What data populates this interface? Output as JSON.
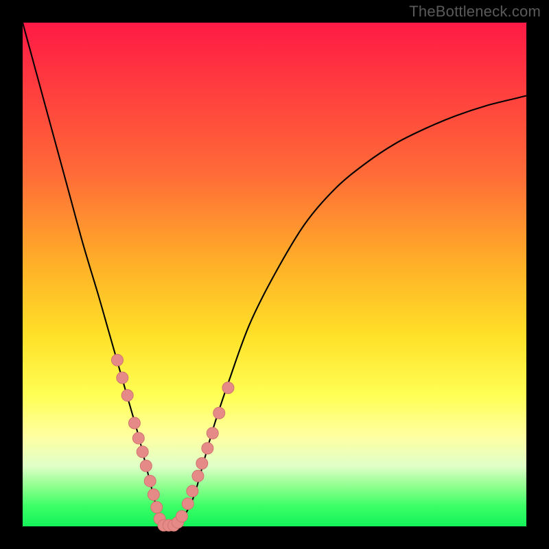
{
  "watermark": {
    "text": "TheBottleneck.com"
  },
  "chart_data": {
    "type": "line",
    "title": "",
    "xlabel": "",
    "ylabel": "",
    "xlim": [
      0,
      100
    ],
    "ylim": [
      0,
      100
    ],
    "grid": false,
    "series": [
      {
        "name": "bottleneck-curve",
        "x": [
          0,
          3,
          6,
          9,
          12,
          15,
          17,
          19,
          21,
          23,
          24.5,
          26,
          27,
          28,
          29,
          30,
          32,
          34,
          36,
          38,
          41,
          45,
          50,
          56,
          62,
          68,
          74,
          80,
          86,
          92,
          98,
          100
        ],
        "y": [
          100,
          89,
          78,
          67,
          56,
          46,
          39,
          32,
          25,
          18,
          12,
          6,
          2,
          0,
          0,
          0,
          2,
          6,
          13,
          20,
          29,
          40,
          50,
          60,
          67,
          72,
          76,
          79,
          81.5,
          83.5,
          85,
          85.5
        ]
      }
    ],
    "markers": {
      "name": "highlight-dots",
      "color": "#e58a87",
      "points": [
        {
          "x": 18.8,
          "y": 33.0
        },
        {
          "x": 19.8,
          "y": 29.5
        },
        {
          "x": 20.8,
          "y": 26.0
        },
        {
          "x": 22.2,
          "y": 20.5
        },
        {
          "x": 23.0,
          "y": 17.5
        },
        {
          "x": 23.8,
          "y": 14.8
        },
        {
          "x": 24.5,
          "y": 12.0
        },
        {
          "x": 25.3,
          "y": 9.0
        },
        {
          "x": 26.0,
          "y": 6.3
        },
        {
          "x": 26.6,
          "y": 3.8
        },
        {
          "x": 27.2,
          "y": 1.5
        },
        {
          "x": 28.0,
          "y": 0.2
        },
        {
          "x": 29.0,
          "y": 0.2
        },
        {
          "x": 30.0,
          "y": 0.2
        },
        {
          "x": 30.8,
          "y": 0.8
        },
        {
          "x": 31.6,
          "y": 2.0
        },
        {
          "x": 32.8,
          "y": 4.5
        },
        {
          "x": 33.7,
          "y": 7.0
        },
        {
          "x": 34.8,
          "y": 10.0
        },
        {
          "x": 35.6,
          "y": 12.5
        },
        {
          "x": 36.7,
          "y": 15.5
        },
        {
          "x": 37.7,
          "y": 18.5
        },
        {
          "x": 39.0,
          "y": 22.5
        },
        {
          "x": 40.8,
          "y": 27.5
        }
      ]
    }
  },
  "colors": {
    "curve_stroke": "#000000",
    "marker_fill": "#e58a87",
    "marker_stroke": "#d07470"
  }
}
